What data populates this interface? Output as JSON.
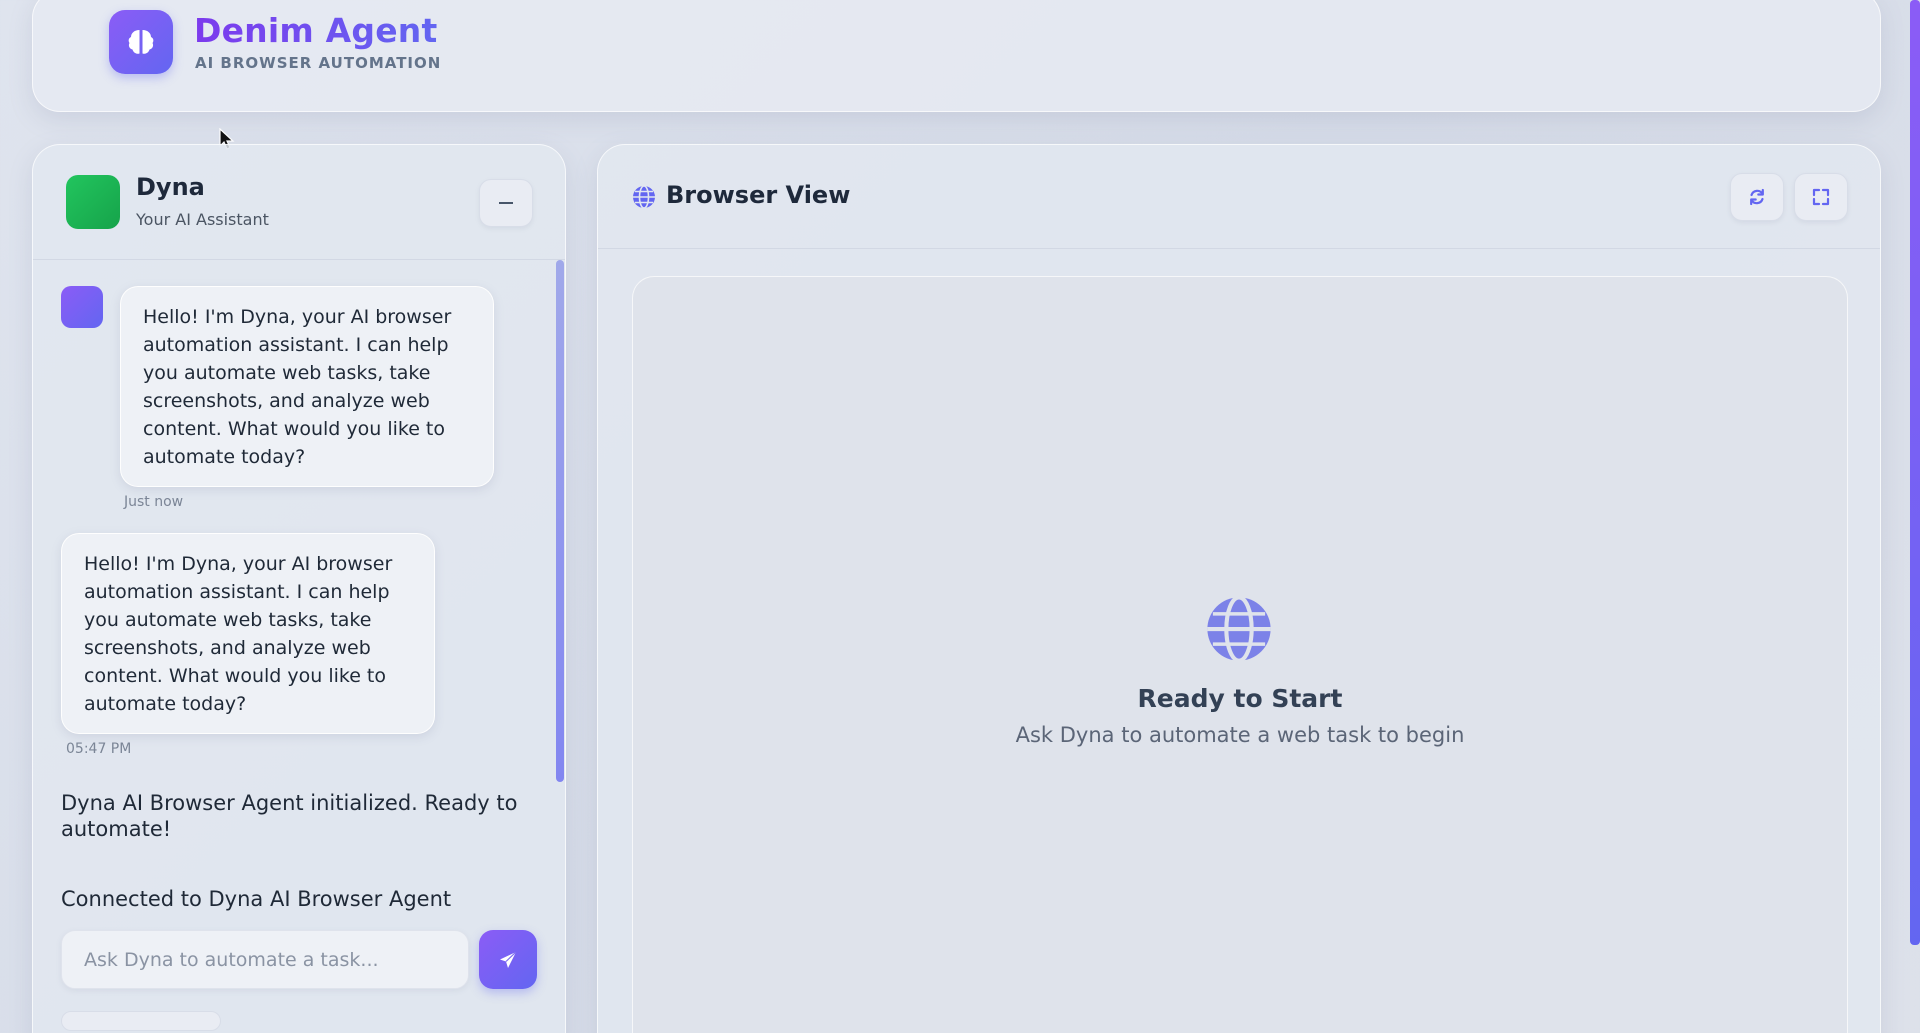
{
  "header": {
    "title": "Denim Agent",
    "subtitle": "AI BROWSER AUTOMATION",
    "logo_icon": "brain-icon"
  },
  "chat": {
    "assistant_name": "Dyna",
    "assistant_role": "Your AI Assistant",
    "minimize_icon": "minus-icon",
    "messages": [
      {
        "sender": "bot",
        "text": "Hello! I'm Dyna, your AI browser automation assistant. I can help you automate web tasks, take screenshots, and analyze web content. What would you like to automate today?",
        "timestamp": "Just now"
      },
      {
        "sender": "bot",
        "text": "Hello! I'm Dyna, your AI browser automation assistant. I can help you automate web tasks, take screenshots, and analyze web content. What would you like to automate today?",
        "timestamp": "05:47 PM"
      }
    ],
    "system_messages": [
      "Dyna AI Browser Agent initialized. Ready to automate!",
      "Connected to Dyna AI Browser Agent"
    ],
    "input_placeholder": "Ask Dyna to automate a task...",
    "input_value": "",
    "send_icon": "paper-plane-icon"
  },
  "browser": {
    "title": "Browser View",
    "title_icon": "globe-icon",
    "refresh_icon": "refresh-icon",
    "fullscreen_icon": "expand-icon",
    "empty_title": "Ready to Start",
    "empty_subtitle": "Ask Dyna to automate a web task to begin"
  },
  "colors": {
    "accent": "#6366f1",
    "accent_purple": "#8b5cf6",
    "assistant_green": "#22c55e",
    "background": "#dfe4ee"
  }
}
